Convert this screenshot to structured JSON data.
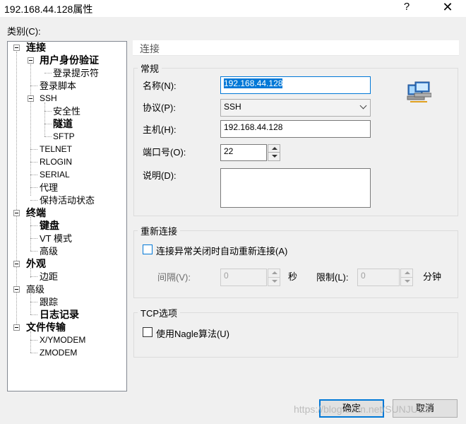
{
  "window": {
    "title": "192.168.44.128属性",
    "help": "?",
    "close": "✕"
  },
  "category_label": "类别(C):",
  "tree": {
    "connection": "连接",
    "auth": "用户身份验证",
    "login_prompt": "登录提示符",
    "login_script": "登录脚本",
    "ssh": "SSH",
    "security": "安全性",
    "tunnel": "隧道",
    "sftp": "SFTP",
    "telnet": "TELNET",
    "rlogin": "RLOGIN",
    "serial": "SERIAL",
    "proxy": "代理",
    "keepalive": "保持活动状态",
    "terminal": "终端",
    "keyboard": "键盘",
    "vt_mode": "VT 模式",
    "advanced_t": "高级",
    "appearance": "外观",
    "margin": "边距",
    "advanced": "高级",
    "trace": "跟踪",
    "logging": "日志记录",
    "file_transfer": "文件传输",
    "xymodem": "X/YMODEM",
    "zmodem": "ZMODEM"
  },
  "section_title": "连接",
  "general": {
    "title": "常规",
    "name_label": "名称(N):",
    "name_value": "192.168.44.128",
    "protocol_label": "协议(P):",
    "protocol_value": "SSH",
    "host_label": "主机(H):",
    "host_value": "192.168.44.128",
    "port_label": "端口号(O):",
    "port_value": "22",
    "desc_label": "说明(D):",
    "desc_value": ""
  },
  "reconnect": {
    "title": "重新连接",
    "auto_label": "连接异常关闭时自动重新连接(A)",
    "interval_label": "间隔(V):",
    "interval_value": "0",
    "interval_unit": "秒",
    "limit_label": "限制(L):",
    "limit_value": "0",
    "limit_unit": "分钟"
  },
  "tcp": {
    "title": "TCP选项",
    "nagle_label": "使用Nagle算法(U)"
  },
  "buttons": {
    "ok": "确定",
    "cancel": "取消"
  },
  "watermark": "https://blog.csdn.net/SUNJUSS",
  "colors": {
    "accent": "#0078d7",
    "background": "#f0f0f0"
  }
}
